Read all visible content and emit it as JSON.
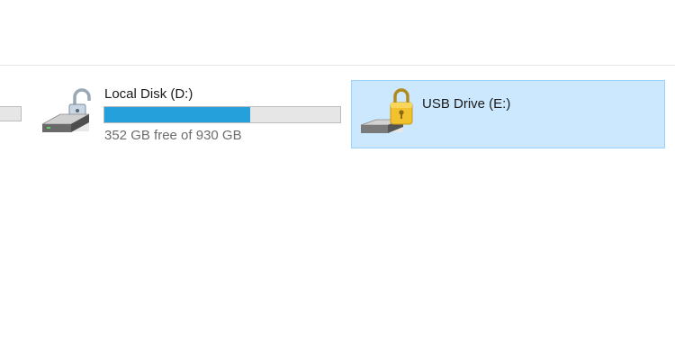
{
  "drives": [
    {
      "name": "Local Disk (D:)",
      "icon": "locked-drive-icon",
      "free_space_text": "352 GB free of 930 GB",
      "used_fraction": 0.62,
      "bar_color": "#26a0da"
    },
    {
      "name": "USB Drive (E:)",
      "icon": "locked-usb-drive-icon",
      "selected": true,
      "selection_color": "#cce8ff",
      "lock_color": "#f2c12e"
    }
  ]
}
